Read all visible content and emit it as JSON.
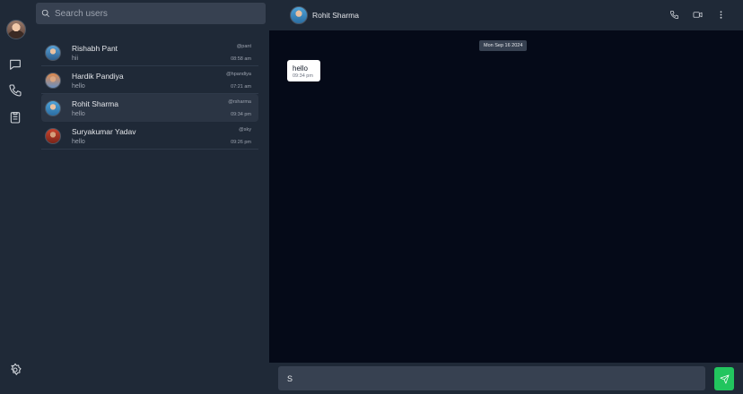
{
  "search": {
    "placeholder": "Search users"
  },
  "chats": [
    {
      "name": "Rishabh Pant",
      "handle": "@pant",
      "last": "hii",
      "time": "08:58 am",
      "avatar_color": "#4a8fc4"
    },
    {
      "name": "Hardik Pandiya",
      "handle": "@hpandiya",
      "last": "hello",
      "time": "07:21 am",
      "avatar_color": "#c86b3c"
    },
    {
      "name": "Rohit Sharma",
      "handle": "@rsharma",
      "last": "hello",
      "time": "09:34 pm",
      "avatar_color": "#3d8cc7"
    },
    {
      "name": "Suryakumar Yadav",
      "handle": "@sky",
      "last": "hello",
      "time": "09:26 pm",
      "avatar_color": "#b23a2a"
    }
  ],
  "active_chat": {
    "name": "Rohit Sharma"
  },
  "messages": {
    "date": "Mon Sep 16 2024",
    "items": [
      {
        "text": "hello",
        "time": "09:34 pm"
      }
    ]
  },
  "composer": {
    "value": "S"
  },
  "colors": {
    "accent": "#22c55e",
    "panel": "#1f2937",
    "background": "#050a18"
  }
}
